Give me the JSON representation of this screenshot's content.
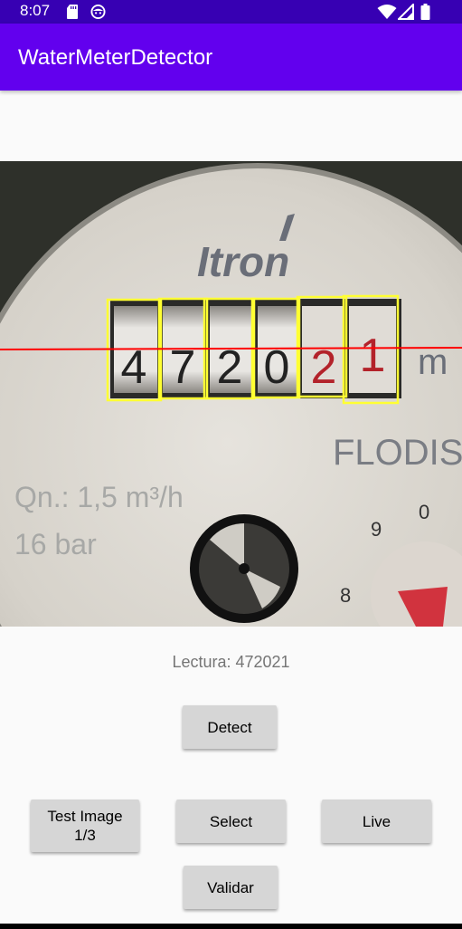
{
  "status_bar": {
    "time": "8:07",
    "icons": [
      "sd-card-icon",
      "face-icon",
      "wifi-icon",
      "signal-icon",
      "battery-icon"
    ]
  },
  "app_bar": {
    "title": "WaterMeterDetector",
    "color": "#6200ee",
    "status_color": "#3700b3"
  },
  "meter_image": {
    "brand": "Itron",
    "marking": "FLODIS - S",
    "flow_text": "Qn.: 1,5 m³/h",
    "pressure_text": "16 bar",
    "unit_text": "m",
    "dial_numbers": [
      "9",
      "0",
      "8"
    ],
    "digits": [
      "4",
      "7",
      "2",
      "0",
      "2",
      "1"
    ],
    "box_color": "#ffff33",
    "line_color": "#ff0000"
  },
  "reading": {
    "label": "Lectura: 472021"
  },
  "buttons": {
    "detect": "Detect",
    "test_image": "Test Image\n1/3",
    "select": "Select",
    "live": "Live",
    "validar": "Validar"
  }
}
